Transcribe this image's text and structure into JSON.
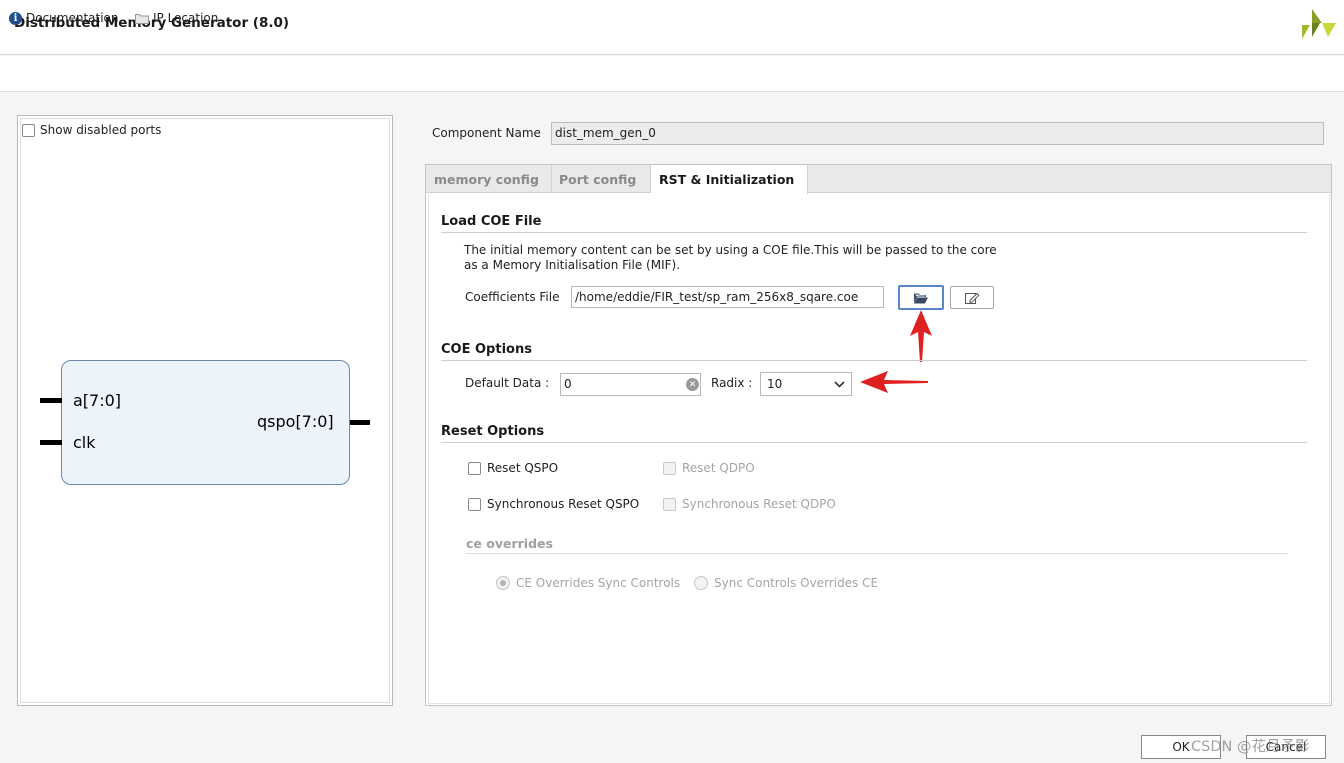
{
  "window": {
    "title": "Distributed Memory Generator (8.0)"
  },
  "toolbar": {
    "documentation": "Documentation",
    "ip_location": "IP Location"
  },
  "symbol": {
    "show_disabled_ports": "Show disabled ports",
    "ports": {
      "a": "a[7:0]",
      "clk": "clk",
      "qspo": "qspo[7:0]"
    }
  },
  "component": {
    "label": "Component Name",
    "value": "dist_mem_gen_0"
  },
  "tabs": [
    "memory config",
    "Port config",
    "RST & Initialization"
  ],
  "load_coe": {
    "title": "Load COE File",
    "description_line1": "The initial memory content can be set by using a COE file.This will be passed to the core",
    "description_line2": "as a Memory Initialisation File (MIF).",
    "coefficients_label": "Coefficients File",
    "coefficients_value": "/home/eddie/FIR_test/sp_ram_256x8_sqare.coe"
  },
  "coe_options": {
    "title": "COE Options",
    "default_data_label": "Default Data :",
    "default_data_value": "0",
    "radix_label": "Radix :",
    "radix_value": "10"
  },
  "reset_options": {
    "title": "Reset Options",
    "reset_qspo": "Reset QSPO",
    "reset_qdpo": "Reset QDPO",
    "sync_reset_qspo": "Synchronous Reset QSPO",
    "sync_reset_qdpo": "Synchronous Reset QDPO"
  },
  "ce_overrides": {
    "title": "ce overrides",
    "option1": "CE Overrides Sync Controls",
    "option2": "Sync Controls Overrides CE"
  },
  "buttons": {
    "ok": "OK",
    "cancel": "Cancel"
  },
  "watermark": "CSDN @花月矛影",
  "colors": {
    "accent_border": "#5a86c8",
    "arrow": "#e02020",
    "block_fill": "#edf3fb"
  }
}
